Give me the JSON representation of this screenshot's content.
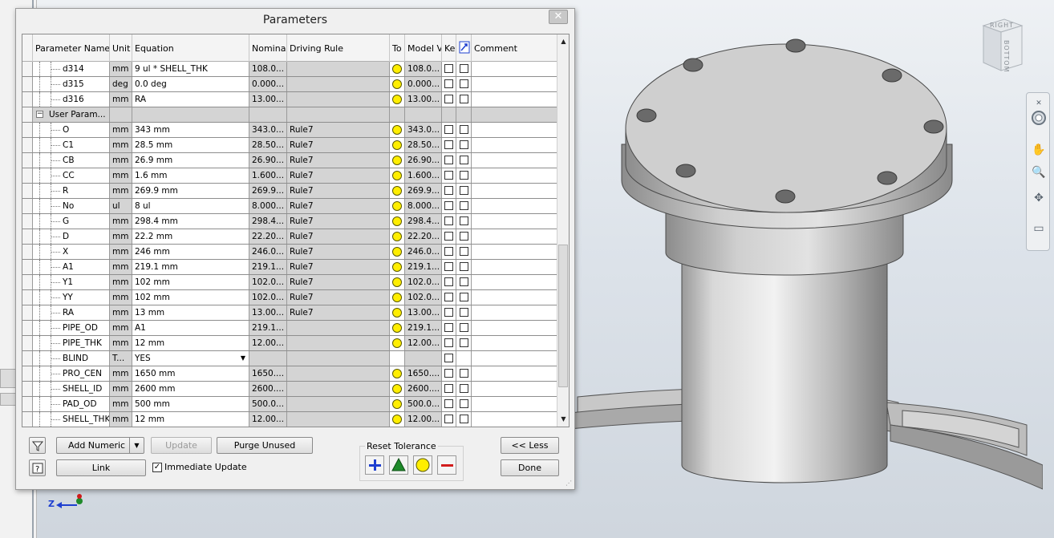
{
  "dialog": {
    "title": "Parameters",
    "close": "✕"
  },
  "columns": [
    "Parameter Name",
    "Unit",
    "Equation",
    "Nominal",
    "Driving Rule",
    "To",
    "Model Va",
    "Ke",
    "",
    "Comment"
  ],
  "rows": [
    {
      "name": "d314",
      "unit": "mm",
      "equation": "9 ul * SHELL_THK",
      "nominal": "108.0...",
      "rule": "",
      "tol": true,
      "model": "108.0...",
      "group": false,
      "level": 2
    },
    {
      "name": "d315",
      "unit": "deg",
      "equation": "0.0 deg",
      "nominal": "0.000...",
      "rule": "",
      "tol": true,
      "model": "0.000...",
      "group": false,
      "level": 2
    },
    {
      "name": "d316",
      "unit": "mm",
      "equation": "RA",
      "nominal": "13.00...",
      "rule": "",
      "tol": true,
      "model": "13.00...",
      "group": false,
      "level": 2
    },
    {
      "name": "User Param...",
      "unit": "",
      "equation": "",
      "nominal": "",
      "rule": "",
      "tol": false,
      "model": "",
      "group": true,
      "level": 1
    },
    {
      "name": "O",
      "unit": "mm",
      "equation": "343 mm",
      "nominal": "343.0...",
      "rule": "Rule7",
      "tol": true,
      "model": "343.0...",
      "group": false,
      "level": 2
    },
    {
      "name": "C1",
      "unit": "mm",
      "equation": "28.5 mm",
      "nominal": "28.50...",
      "rule": "Rule7",
      "tol": true,
      "model": "28.50...",
      "group": false,
      "level": 2
    },
    {
      "name": "CB",
      "unit": "mm",
      "equation": "26.9 mm",
      "nominal": "26.90...",
      "rule": "Rule7",
      "tol": true,
      "model": "26.90...",
      "group": false,
      "level": 2
    },
    {
      "name": "CC",
      "unit": "mm",
      "equation": "1.6 mm",
      "nominal": "1.600...",
      "rule": "Rule7",
      "tol": true,
      "model": "1.600...",
      "group": false,
      "level": 2
    },
    {
      "name": "R",
      "unit": "mm",
      "equation": "269.9 mm",
      "nominal": "269.9...",
      "rule": "Rule7",
      "tol": true,
      "model": "269.9...",
      "group": false,
      "level": 2
    },
    {
      "name": "No",
      "unit": "ul",
      "equation": "8 ul",
      "nominal": "8.000...",
      "rule": "Rule7",
      "tol": true,
      "model": "8.000...",
      "group": false,
      "level": 2
    },
    {
      "name": "G",
      "unit": "mm",
      "equation": "298.4 mm",
      "nominal": "298.4...",
      "rule": "Rule7",
      "tol": true,
      "model": "298.4...",
      "group": false,
      "level": 2
    },
    {
      "name": "D",
      "unit": "mm",
      "equation": "22.2 mm",
      "nominal": "22.20...",
      "rule": "Rule7",
      "tol": true,
      "model": "22.20...",
      "group": false,
      "level": 2
    },
    {
      "name": "X",
      "unit": "mm",
      "equation": "246 mm",
      "nominal": "246.0...",
      "rule": "Rule7",
      "tol": true,
      "model": "246.0...",
      "group": false,
      "level": 2
    },
    {
      "name": "A1",
      "unit": "mm",
      "equation": "219.1 mm",
      "nominal": "219.1...",
      "rule": "Rule7",
      "tol": true,
      "model": "219.1...",
      "group": false,
      "level": 2
    },
    {
      "name": "Y1",
      "unit": "mm",
      "equation": "102 mm",
      "nominal": "102.0...",
      "rule": "Rule7",
      "tol": true,
      "model": "102.0...",
      "group": false,
      "level": 2
    },
    {
      "name": "YY",
      "unit": "mm",
      "equation": "102 mm",
      "nominal": "102.0...",
      "rule": "Rule7",
      "tol": true,
      "model": "102.0...",
      "group": false,
      "level": 2
    },
    {
      "name": "RA",
      "unit": "mm",
      "equation": "13 mm",
      "nominal": "13.00...",
      "rule": "Rule7",
      "tol": true,
      "model": "13.00...",
      "group": false,
      "level": 2
    },
    {
      "name": "PIPE_OD",
      "unit": "mm",
      "equation": "A1",
      "nominal": "219.1...",
      "rule": "",
      "tol": true,
      "model": "219.1...",
      "group": false,
      "level": 2
    },
    {
      "name": "PIPE_THK",
      "unit": "mm",
      "equation": "12 mm",
      "nominal": "12.00...",
      "rule": "",
      "tol": true,
      "model": "12.00...",
      "group": false,
      "level": 2
    },
    {
      "name": "BLIND",
      "unit": "T...",
      "equation": "YES",
      "nominal": "",
      "rule": "",
      "tol": false,
      "model": "",
      "group": false,
      "level": 2,
      "dropdown": true
    },
    {
      "name": "PRO_CEN",
      "unit": "mm",
      "equation": "1650 mm",
      "nominal": "1650....",
      "rule": "",
      "tol": true,
      "model": "1650....",
      "group": false,
      "level": 2
    },
    {
      "name": "SHELL_ID",
      "unit": "mm",
      "equation": "2600 mm",
      "nominal": "2600....",
      "rule": "",
      "tol": true,
      "model": "2600....",
      "group": false,
      "level": 2
    },
    {
      "name": "PAD_OD",
      "unit": "mm",
      "equation": "500 mm",
      "nominal": "500.0...",
      "rule": "",
      "tol": true,
      "model": "500.0...",
      "group": false,
      "level": 2
    },
    {
      "name": "SHELL_THK",
      "unit": "mm",
      "equation": "12 mm",
      "nominal": "12.00...",
      "rule": "",
      "tol": true,
      "model": "12.00...",
      "group": false,
      "level": 2
    }
  ],
  "buttons": {
    "add_numeric": "Add Numeric",
    "update": "Update",
    "purge": "Purge Unused",
    "link": "Link",
    "immediate_update": "Immediate Update",
    "less": "<< Less",
    "done": "Done"
  },
  "reset": {
    "label": "Reset Tolerance"
  },
  "viewcube": {
    "right": "RIGHT",
    "bottom": "BOTTOM"
  },
  "triad": {
    "z": "Z"
  },
  "colors": {
    "tolerance_dot": "#ffee00",
    "reset_plus": "#1e3fd0",
    "reset_tri": "#1e8a2a",
    "reset_circle": "#ffee00",
    "reset_minus": "#d21c1c"
  }
}
